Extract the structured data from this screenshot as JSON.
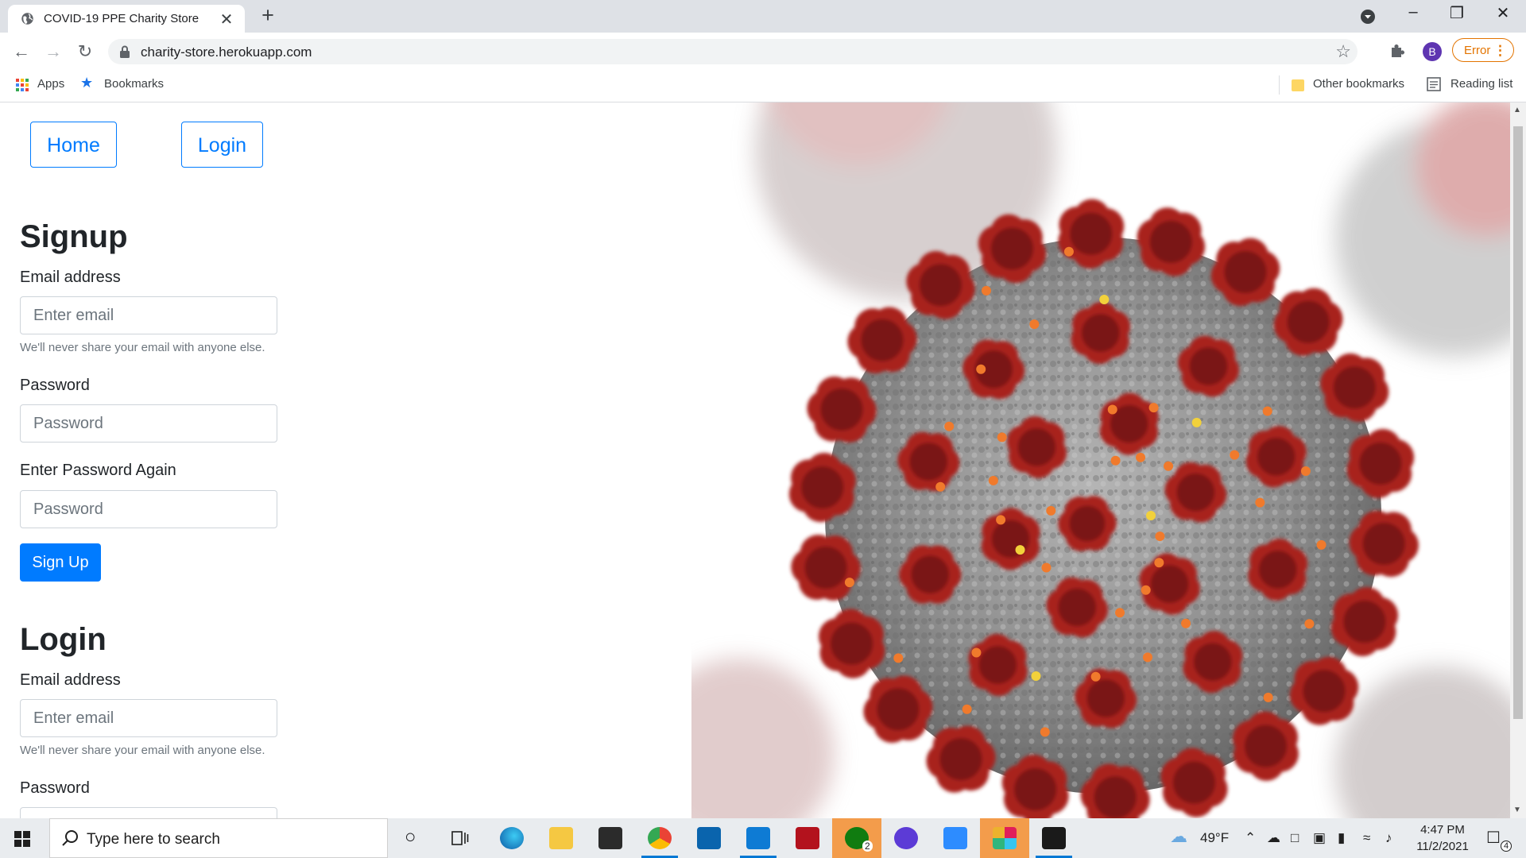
{
  "browser": {
    "tab_title": "COVID-19 PPE Charity Store",
    "tab_close": "✕",
    "new_tab": "+",
    "url": "charity-store.herokuapp.com",
    "profile_initial": "B",
    "error_label": "Error",
    "bookmarks": {
      "apps": "Apps",
      "bookmarks": "Bookmarks",
      "other": "Other bookmarks",
      "reading_list": "Reading list"
    }
  },
  "nav": {
    "home": "Home",
    "login": "Login"
  },
  "signup": {
    "title": "Signup",
    "email_label": "Email address",
    "email_placeholder": "Enter email",
    "email_help": "We'll never share your email with anyone else.",
    "password_label": "Password",
    "password_placeholder": "Password",
    "password_again_label": "Enter Password Again",
    "password_again_placeholder": "Password",
    "submit": "Sign Up"
  },
  "login": {
    "title": "Login",
    "email_label": "Email address",
    "email_placeholder": "Enter email",
    "email_help": "We'll never share your email with anyone else.",
    "password_label": "Password"
  },
  "taskbar": {
    "search_placeholder": "Type here to search",
    "weather": "49°F",
    "time": "4:47 PM",
    "date": "11/2/2021",
    "notifications": "4",
    "xbox_badge": "2"
  },
  "colors": {
    "primary": "#007bff",
    "virus_red": "#a8201f",
    "virus_gray": "#8c8c8c",
    "error_orange": "#e37400"
  }
}
